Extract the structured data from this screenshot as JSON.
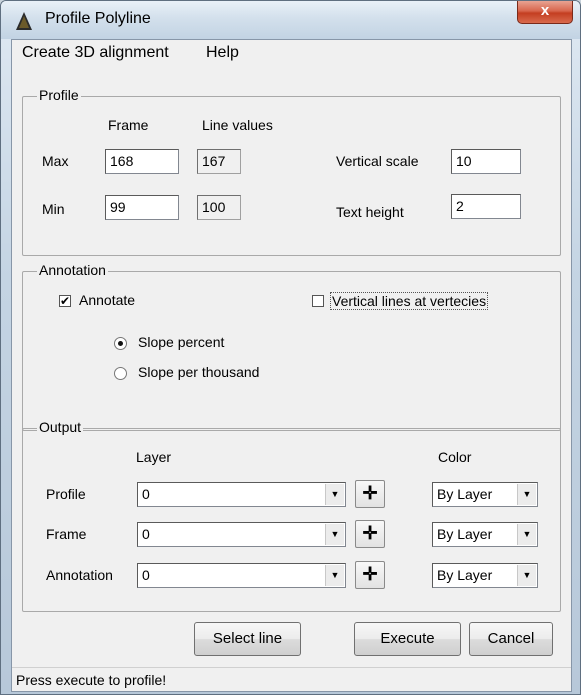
{
  "window": {
    "title": "Profile Polyline",
    "close_glyph": "x",
    "app_icon": "warning-triangle-icon"
  },
  "menu": {
    "create_3d": "Create 3D alignment",
    "help": "Help"
  },
  "profile": {
    "group_label": "Profile",
    "col_frame": "Frame",
    "col_line_values": "Line values",
    "max_label": "Max",
    "min_label": "Min",
    "max_frame": "168",
    "max_line": "167",
    "min_frame": "99",
    "min_line": "100",
    "vertical_scale_label": "Vertical scale",
    "vertical_scale": "10",
    "text_height_label": "Text height",
    "text_height": "2"
  },
  "annotation": {
    "group_label": "Annotation",
    "annotate_label": "Annotate",
    "annotate_checked": true,
    "vertical_lines_label": "Vertical lines at vertecies",
    "vertical_lines_checked": false,
    "slope_percent_label": "Slope percent",
    "slope_per_thousand_label": "Slope per thousand",
    "selected_slope": "Slope percent"
  },
  "output": {
    "group_label": "Output",
    "col_layer": "Layer",
    "col_color": "Color",
    "rows": [
      {
        "label": "Profile",
        "layer": "0",
        "color": "By Layer"
      },
      {
        "label": "Frame",
        "layer": "0",
        "color": "By Layer"
      },
      {
        "label": "Annotation",
        "layer": "0",
        "color": "By Layer"
      }
    ]
  },
  "buttons": {
    "select_line": "Select line",
    "execute": "Execute",
    "cancel": "Cancel"
  },
  "status": "Press execute to profile!"
}
